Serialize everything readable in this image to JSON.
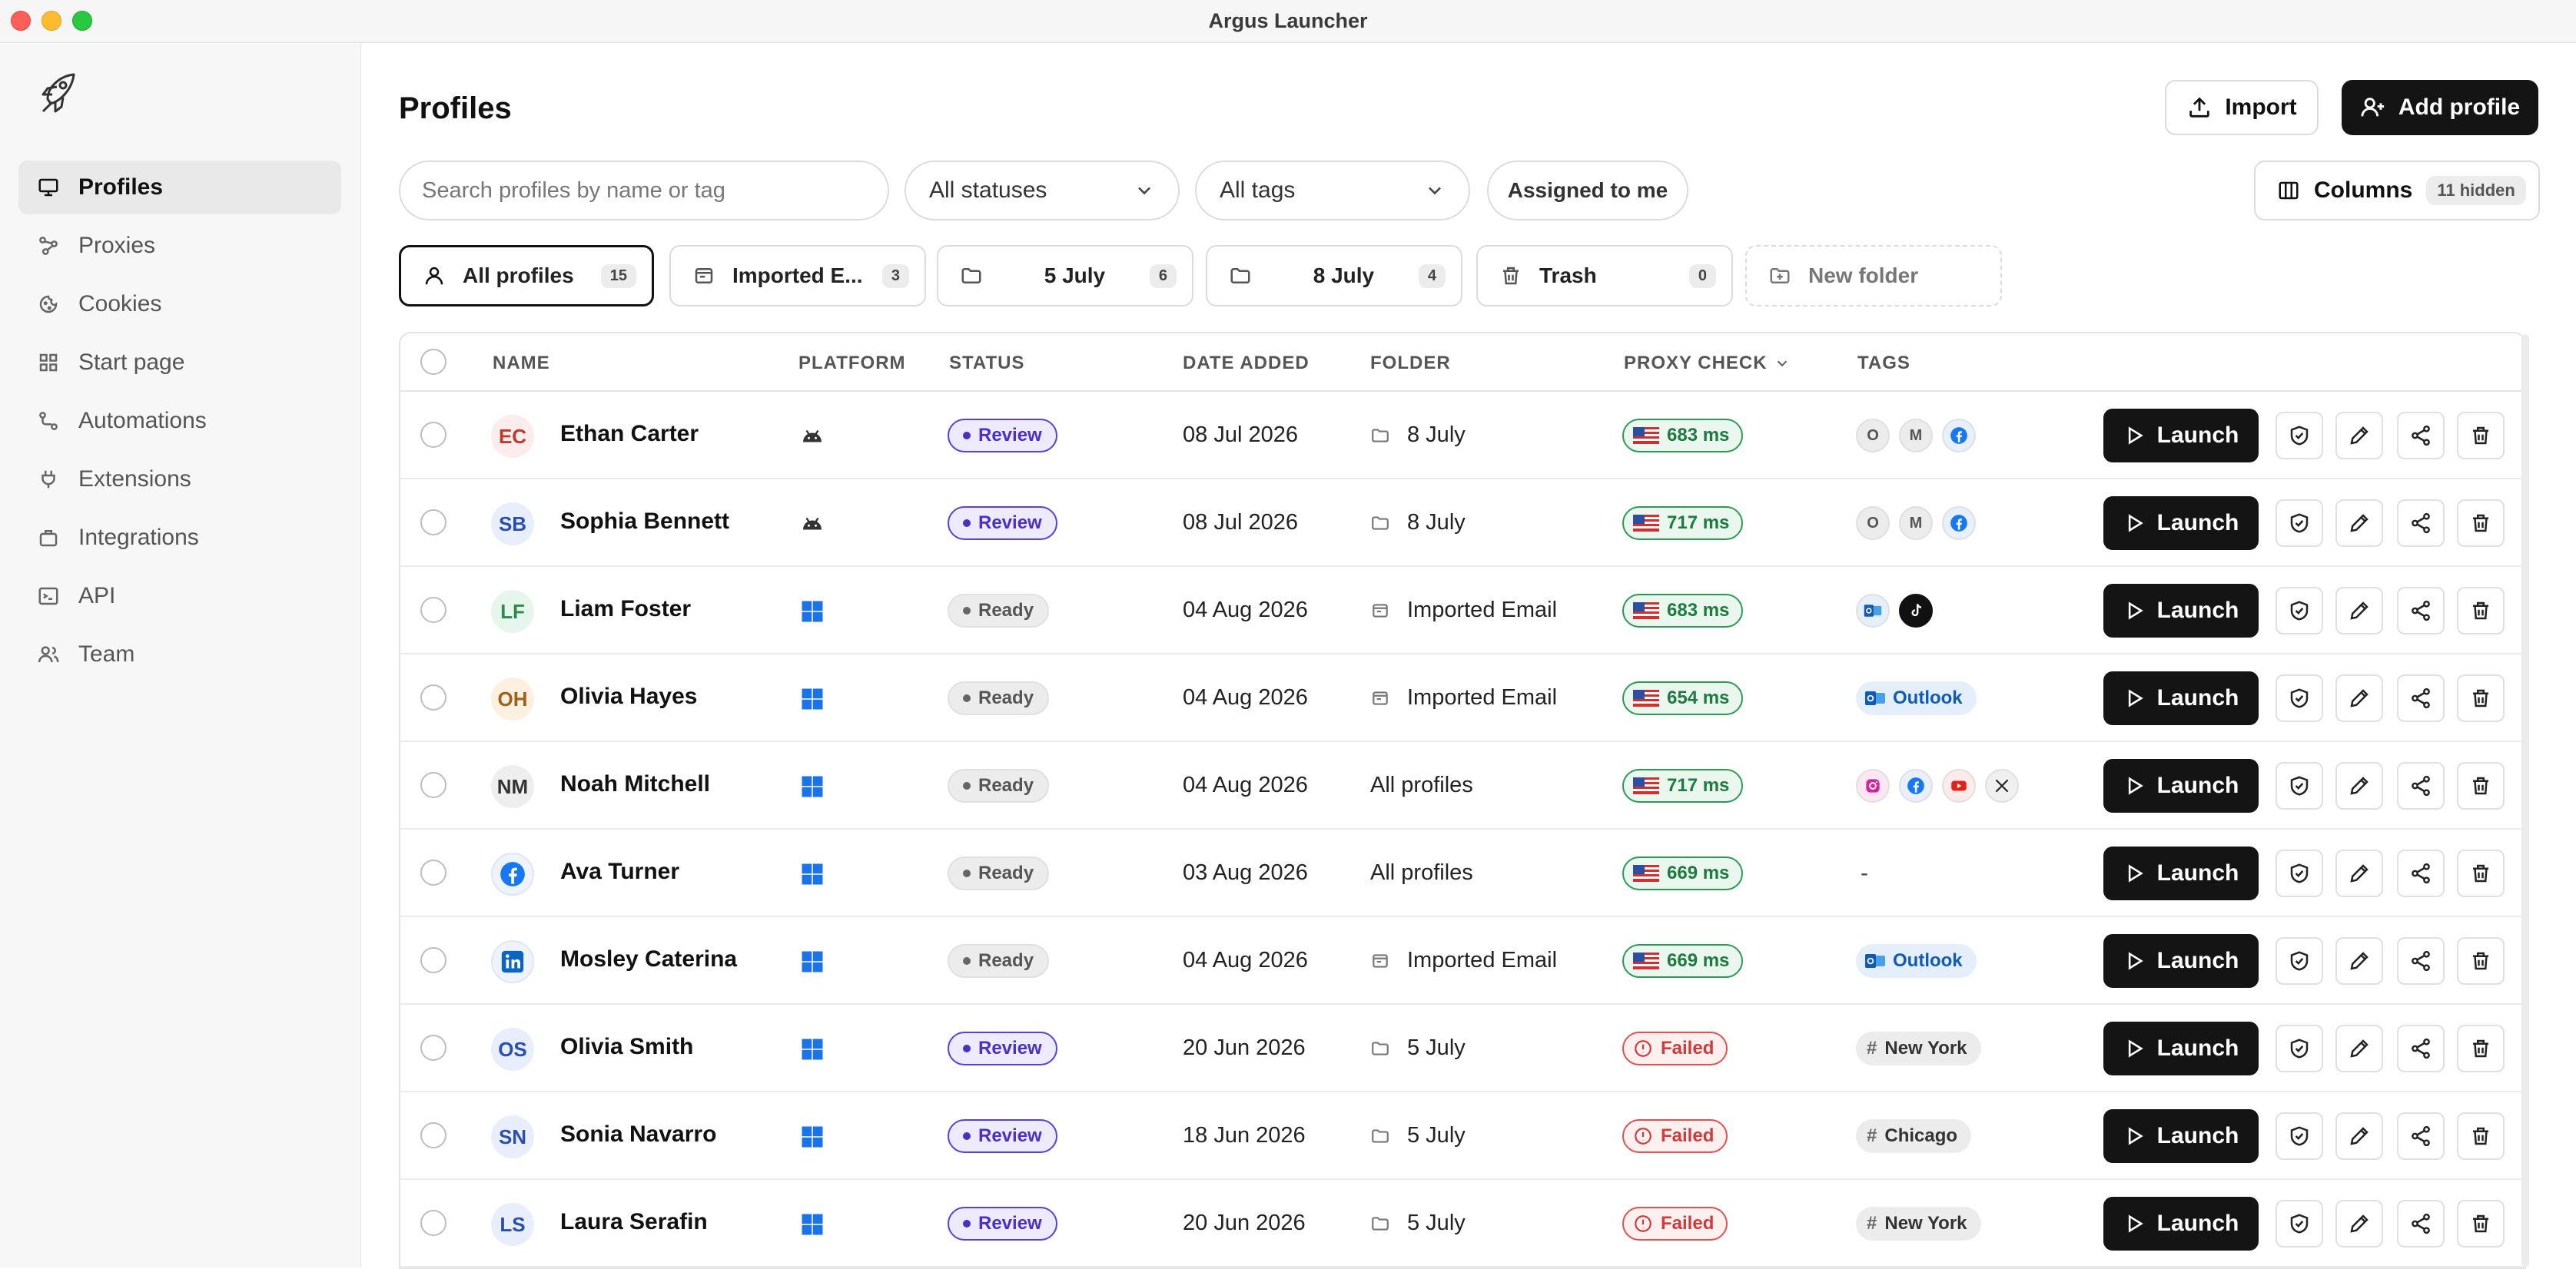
{
  "window": {
    "title": "Argus Launcher"
  },
  "sidebar": {
    "items": [
      {
        "label": "Profiles",
        "icon": "monitor-icon",
        "active": true
      },
      {
        "label": "Proxies",
        "icon": "proxy-icon"
      },
      {
        "label": "Cookies",
        "icon": "cookie-icon"
      },
      {
        "label": "Start page",
        "icon": "grid-icon"
      },
      {
        "label": "Automations",
        "icon": "automation-icon"
      },
      {
        "label": "Extensions",
        "icon": "plug-icon"
      },
      {
        "label": "Integrations",
        "icon": "integration-icon"
      },
      {
        "label": "API",
        "icon": "terminal-icon"
      },
      {
        "label": "Team",
        "icon": "team-icon"
      }
    ]
  },
  "header": {
    "title": "Profiles",
    "import_label": "Import",
    "add_label": "Add profile"
  },
  "filters": {
    "search_placeholder": "Search profiles by name or tag",
    "status_label": "All statuses",
    "tags_label": "All tags",
    "assigned_label": "Assigned to me",
    "columns_label": "Columns",
    "columns_hidden": "11 hidden"
  },
  "folders": [
    {
      "label": "All profiles",
      "count": "15",
      "icon": "user-icon",
      "active": true
    },
    {
      "label": "Imported E...",
      "count": "3",
      "icon": "mail-folder-icon"
    },
    {
      "label": "5 July",
      "count": "6",
      "icon": "folder-icon"
    },
    {
      "label": "8 July",
      "count": "4",
      "icon": "folder-icon"
    },
    {
      "label": "Trash",
      "count": "0",
      "icon": "trash-icon"
    },
    {
      "label": "New folder",
      "icon": "folder-plus-icon"
    }
  ],
  "table": {
    "columns": [
      "NAME",
      "PLATFORM",
      "STATUS",
      "DATE ADDED",
      "FOLDER",
      "PROXY CHECK",
      "TAGS"
    ],
    "launch_label": "Launch",
    "rows": [
      {
        "initials": "EC",
        "name": "Ethan Carter",
        "platform": "android",
        "status": "Review",
        "date": "08 Jul 2026",
        "folder": "8 July",
        "folder_icon": "folder",
        "proxy": "683 ms",
        "proxy_ok": true,
        "tags": [
          "O",
          "M",
          "facebook"
        ],
        "avatar_color": "#c0392b",
        "avatar_bg": "#fdecec"
      },
      {
        "initials": "SB",
        "name": "Sophia Bennett",
        "platform": "android",
        "status": "Review",
        "date": "08 Jul 2026",
        "folder": "8 July",
        "folder_icon": "folder",
        "proxy": "717 ms",
        "proxy_ok": true,
        "tags": [
          "O",
          "M",
          "facebook"
        ],
        "avatar_color": "#2a4fb0",
        "avatar_bg": "#e8eefc"
      },
      {
        "initials": "LF",
        "name": "Liam Foster",
        "platform": "windows",
        "status": "Ready",
        "date": "04 Aug 2026",
        "folder": "Imported Email",
        "folder_icon": "mail",
        "proxy": "683 ms",
        "proxy_ok": true,
        "tags": [
          "outlook-icon",
          "tiktok"
        ],
        "avatar_color": "#2e8a4a",
        "avatar_bg": "#e7f6ec"
      },
      {
        "initials": "OH",
        "name": "Olivia Hayes",
        "platform": "windows",
        "status": "Ready",
        "date": "04 Aug 2026",
        "folder": "Imported Email",
        "folder_icon": "mail",
        "proxy": "654 ms",
        "proxy_ok": true,
        "tags": [
          "Outlook"
        ],
        "avatar_color": "#a0621a",
        "avatar_bg": "#fcf0e1"
      },
      {
        "initials": "NM",
        "name": "Noah Mitchell",
        "platform": "windows",
        "status": "Ready",
        "date": "04 Aug 2026",
        "folder": "All profiles",
        "folder_icon": "",
        "proxy": "717 ms",
        "proxy_ok": true,
        "tags": [
          "instagram",
          "facebook",
          "youtube",
          "x"
        ],
        "avatar_color": "#333333",
        "avatar_bg": "#eeeeee"
      },
      {
        "initials": "",
        "name": "Ava Turner",
        "platform": "windows",
        "status": "Ready",
        "date": "03 Aug 2026",
        "folder": "All profiles",
        "folder_icon": "",
        "proxy": "669 ms",
        "proxy_ok": true,
        "tags": [
          "-"
        ],
        "avatar_logo": "facebook"
      },
      {
        "initials": "",
        "name": "Mosley Caterina",
        "platform": "windows",
        "status": "Ready",
        "date": "04 Aug 2026",
        "folder": "Imported Email",
        "folder_icon": "mail",
        "proxy": "669 ms",
        "proxy_ok": true,
        "tags": [
          "Outlook"
        ],
        "avatar_logo": "linkedin"
      },
      {
        "initials": "OS",
        "name": "Olivia Smith",
        "platform": "windows",
        "status": "Review",
        "date": "20 Jun 2026",
        "folder": "5 July",
        "folder_icon": "folder",
        "proxy": "Failed",
        "proxy_ok": false,
        "tags": [
          "# New York"
        ],
        "avatar_color": "#2a4fb0",
        "avatar_bg": "#e8eefc"
      },
      {
        "initials": "SN",
        "name": "Sonia Navarro",
        "platform": "windows",
        "status": "Review",
        "date": "18 Jun 2026",
        "folder": "5 July",
        "folder_icon": "folder",
        "proxy": "Failed",
        "proxy_ok": false,
        "tags": [
          "# Chicago"
        ],
        "avatar_color": "#2a4fb0",
        "avatar_bg": "#e8eefc"
      },
      {
        "initials": "LS",
        "name": "Laura Serafin",
        "platform": "windows",
        "status": "Review",
        "date": "20 Jun 2026",
        "folder": "5 July",
        "folder_icon": "folder",
        "proxy": "Failed",
        "proxy_ok": false,
        "tags": [
          "# New York"
        ],
        "avatar_color": "#2a4fb0",
        "avatar_bg": "#e8eefc"
      }
    ]
  }
}
